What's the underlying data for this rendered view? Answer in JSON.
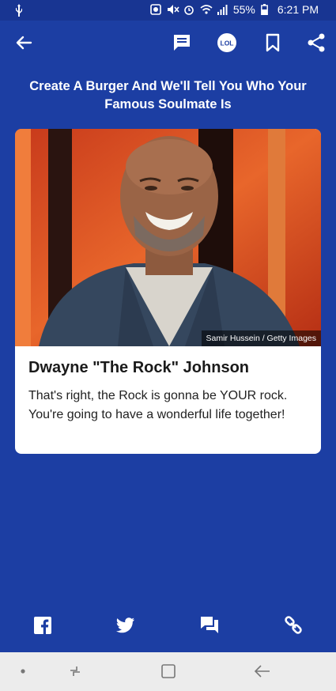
{
  "status_bar": {
    "battery": "55%",
    "time": "6:21 PM"
  },
  "toolbar": {
    "icons": [
      "back-arrow-icon",
      "comment-icon",
      "lol-badge-icon",
      "bookmark-icon",
      "share-icon"
    ],
    "lol_label": "LOL"
  },
  "article": {
    "headline": "Create A Burger And We'll Tell You Who Your Famous Soulmate Is"
  },
  "result_card": {
    "image_credit": "Samir Hussein / Getty Images",
    "title": "Dwayne \"The Rock\" Johnson",
    "description": "That's right, the Rock is gonna be YOUR rock. You're going to have a wonderful life together!"
  },
  "share_bar": {
    "icons": [
      "facebook-icon",
      "twitter-icon",
      "comment-icon",
      "link-icon"
    ]
  },
  "nav_bar": {
    "icons": [
      "dot-icon",
      "recents-icon",
      "home-icon",
      "back-icon"
    ]
  },
  "colors": {
    "background": "#1c3ea3",
    "status_bar": "#183592",
    "card": "#ffffff",
    "nav_bar": "#ececec"
  }
}
